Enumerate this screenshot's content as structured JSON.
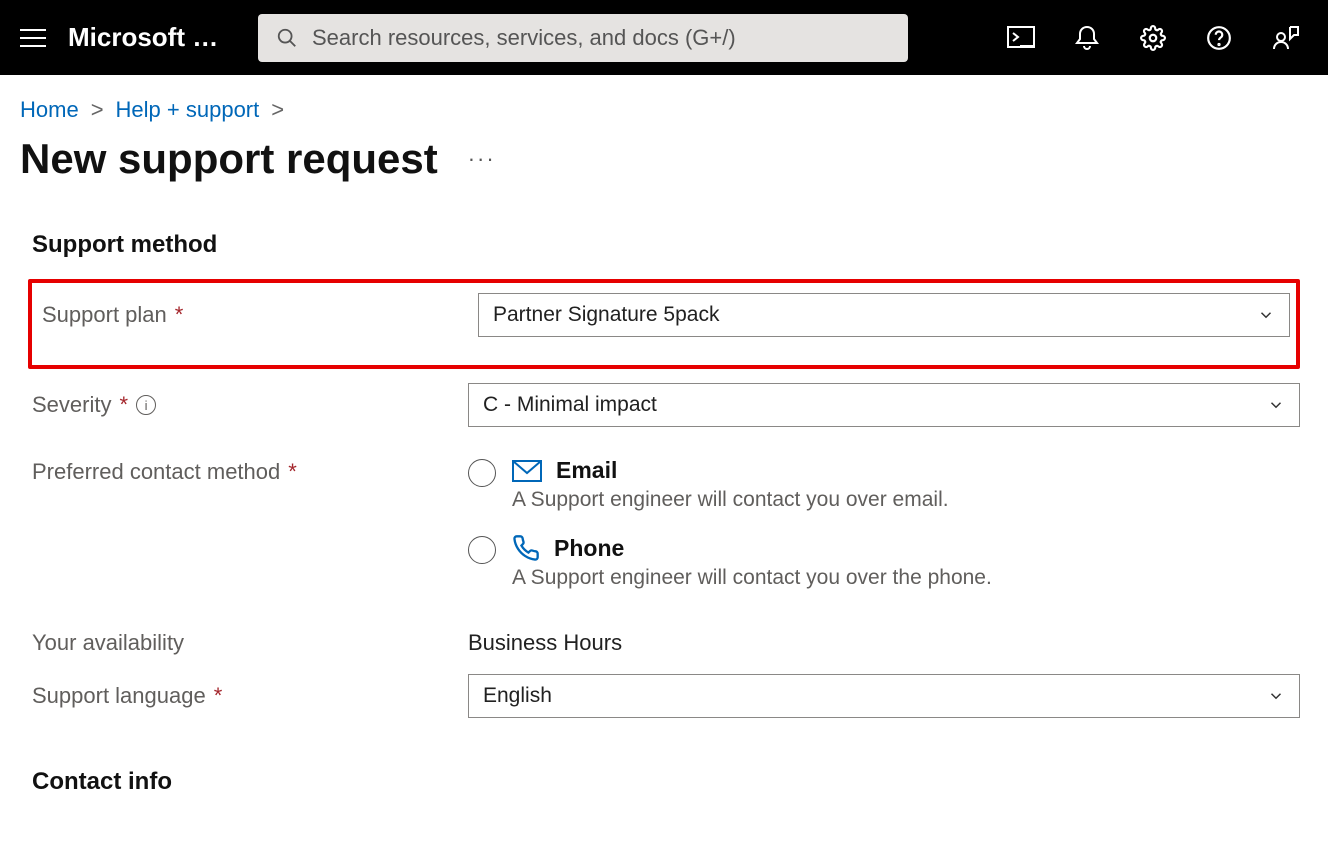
{
  "header": {
    "brand": "Microsoft …",
    "search_placeholder": "Search resources, services, and docs (G+/)"
  },
  "breadcrumb": {
    "home": "Home",
    "help": "Help + support"
  },
  "page": {
    "title": "New support request"
  },
  "sections": {
    "support_method": "Support method",
    "contact_info": "Contact info"
  },
  "fields": {
    "support_plan": {
      "label": "Support plan",
      "value": "Partner Signature 5pack"
    },
    "severity": {
      "label": "Severity",
      "value": "C - Minimal impact"
    },
    "preferred_contact": {
      "label": "Preferred contact method",
      "options": {
        "email": {
          "title": "Email",
          "desc": "A Support engineer will contact you over email."
        },
        "phone": {
          "title": "Phone",
          "desc": "A Support engineer will contact you over the phone."
        }
      }
    },
    "availability": {
      "label": "Your availability",
      "value": "Business Hours"
    },
    "language": {
      "label": "Support language",
      "value": "English"
    }
  }
}
